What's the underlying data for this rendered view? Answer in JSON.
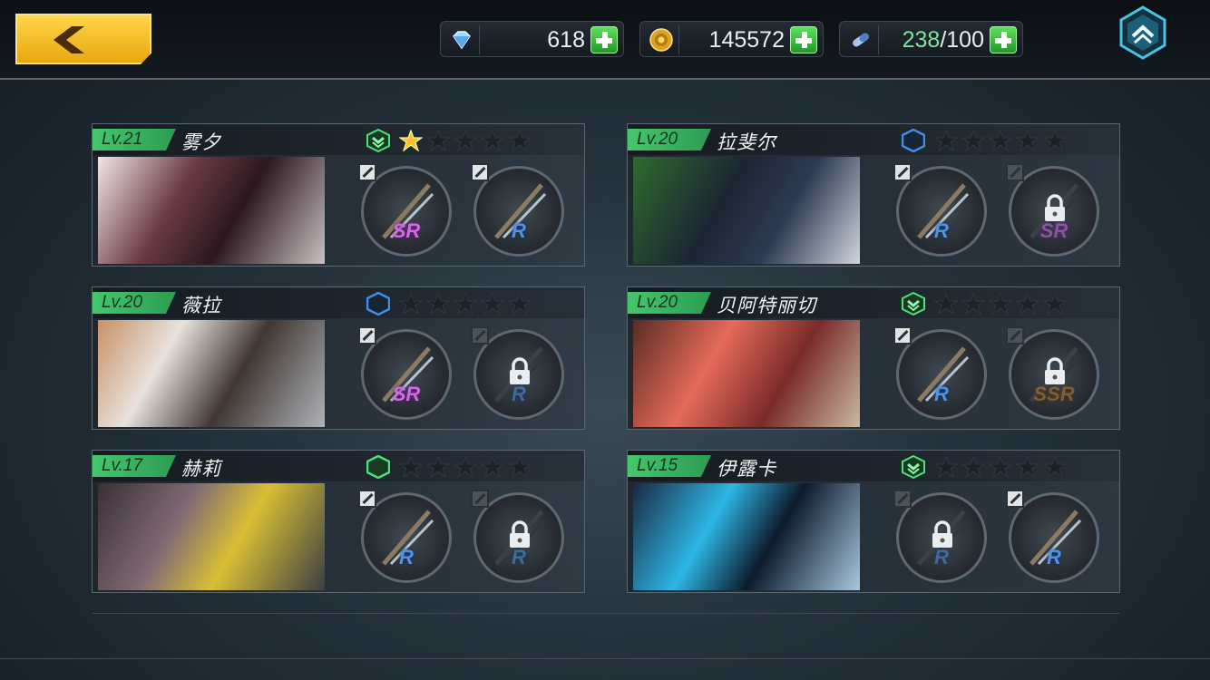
{
  "topbar": {
    "back_icon": "chevron-left-icon",
    "resources": [
      {
        "icon": "diamond-icon",
        "value": "618",
        "highlight": "",
        "max": ""
      },
      {
        "icon": "coin-icon",
        "value": "145572",
        "highlight": "",
        "max": ""
      },
      {
        "icon": "stamina-icon",
        "value": "",
        "highlight": "238",
        "max": "/100"
      }
    ],
    "home_icon": "collapse-up-icon"
  },
  "cards": [
    {
      "level": "Lv.21",
      "name": "雾夕",
      "rank": "green-chevron",
      "stars_filled": 1,
      "weapons": [
        {
          "rarity": "SR",
          "locked": false
        },
        {
          "rarity": "R",
          "locked": false
        }
      ]
    },
    {
      "level": "Lv.20",
      "name": "拉斐尔",
      "rank": "blue-hex",
      "stars_filled": 0,
      "weapons": [
        {
          "rarity": "R",
          "locked": false
        },
        {
          "rarity": "SR",
          "locked": true
        }
      ]
    },
    {
      "level": "Lv.20",
      "name": "薇拉",
      "rank": "blue-hex",
      "stars_filled": 0,
      "weapons": [
        {
          "rarity": "SR",
          "locked": false
        },
        {
          "rarity": "R",
          "locked": true
        }
      ]
    },
    {
      "level": "Lv.20",
      "name": "贝阿特丽切",
      "rank": "green-chevron",
      "stars_filled": 0,
      "weapons": [
        {
          "rarity": "R",
          "locked": false
        },
        {
          "rarity": "SSR",
          "locked": true
        }
      ]
    },
    {
      "level": "Lv.17",
      "name": "赫莉",
      "rank": "green-hex",
      "stars_filled": 0,
      "weapons": [
        {
          "rarity": "R",
          "locked": false
        },
        {
          "rarity": "R",
          "locked": true
        }
      ]
    },
    {
      "level": "Lv.15",
      "name": "伊露卡",
      "rank": "green-chevron",
      "stars_filled": 0,
      "weapons": [
        {
          "rarity": "R",
          "locked": true
        },
        {
          "rarity": "R",
          "locked": false
        }
      ]
    }
  ],
  "colors": {
    "accent": "#45c76c",
    "gold": "#f7c325",
    "sr": "#d469e8",
    "r": "#4f92e8",
    "ssr": "#c77b23"
  }
}
